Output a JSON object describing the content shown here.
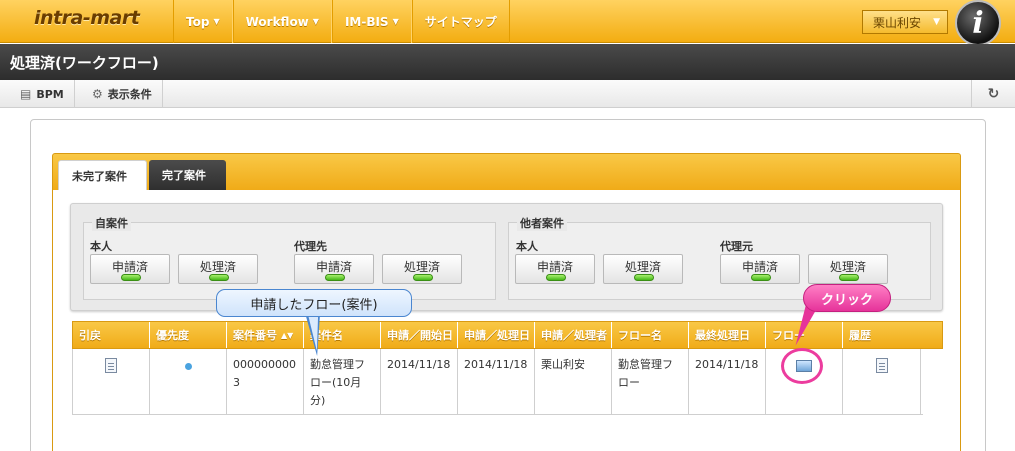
{
  "header": {
    "logo": "intra-mart",
    "nav": [
      {
        "label": "Top",
        "has_caret": true
      },
      {
        "label": "Workflow",
        "has_caret": true
      },
      {
        "label": "IM-BIS",
        "has_caret": true
      },
      {
        "label": "サイトマップ",
        "has_caret": false
      }
    ],
    "user": "栗山利安",
    "avatar_letter": "i"
  },
  "title": "処理済(ワークフロー)",
  "toolbar": {
    "bpm_label": "BPM",
    "conditions_label": "表示条件",
    "refresh_icon": "refresh-icon"
  },
  "tabs": [
    {
      "label": "未完了案件",
      "active": true
    },
    {
      "label": "完了案件",
      "active": false
    }
  ],
  "summary": {
    "own": {
      "legend": "自案件",
      "groups": [
        {
          "label": "本人",
          "buttons": [
            "申請済",
            "処理済"
          ]
        },
        {
          "label": "代理先",
          "buttons": [
            "申請済",
            "処理済"
          ]
        }
      ]
    },
    "others": {
      "legend": "他者案件",
      "groups": [
        {
          "label": "本人",
          "buttons": [
            "申請済",
            "処理済"
          ]
        },
        {
          "label": "代理元",
          "buttons": [
            "申請済",
            "処理済"
          ]
        }
      ]
    }
  },
  "table": {
    "columns": [
      "引戻",
      "優先度",
      "案件番号",
      "案件名",
      "申請／開始日",
      "申請／処理日",
      "申請／処理者",
      "フロー名",
      "最終処理日",
      "フロー",
      "履歴"
    ],
    "rows": [
      {
        "case_number": "0000000003",
        "case_name": "勤怠管理フロー(10月分)",
        "start_date": "2014/11/18",
        "process_date": "2014/11/18",
        "processor": "栗山利安",
        "flow_name": "勤怠管理フロー",
        "last_date": "2014/11/18"
      }
    ]
  },
  "annotations": {
    "blue_callout": "申請したフロー(案件)",
    "pink_callout": "クリック"
  },
  "colors": {
    "accent": "#f3ad11",
    "dark_bar": "#333333",
    "callout_pink": "#e6339a",
    "callout_blue_border": "#4a86d0"
  }
}
